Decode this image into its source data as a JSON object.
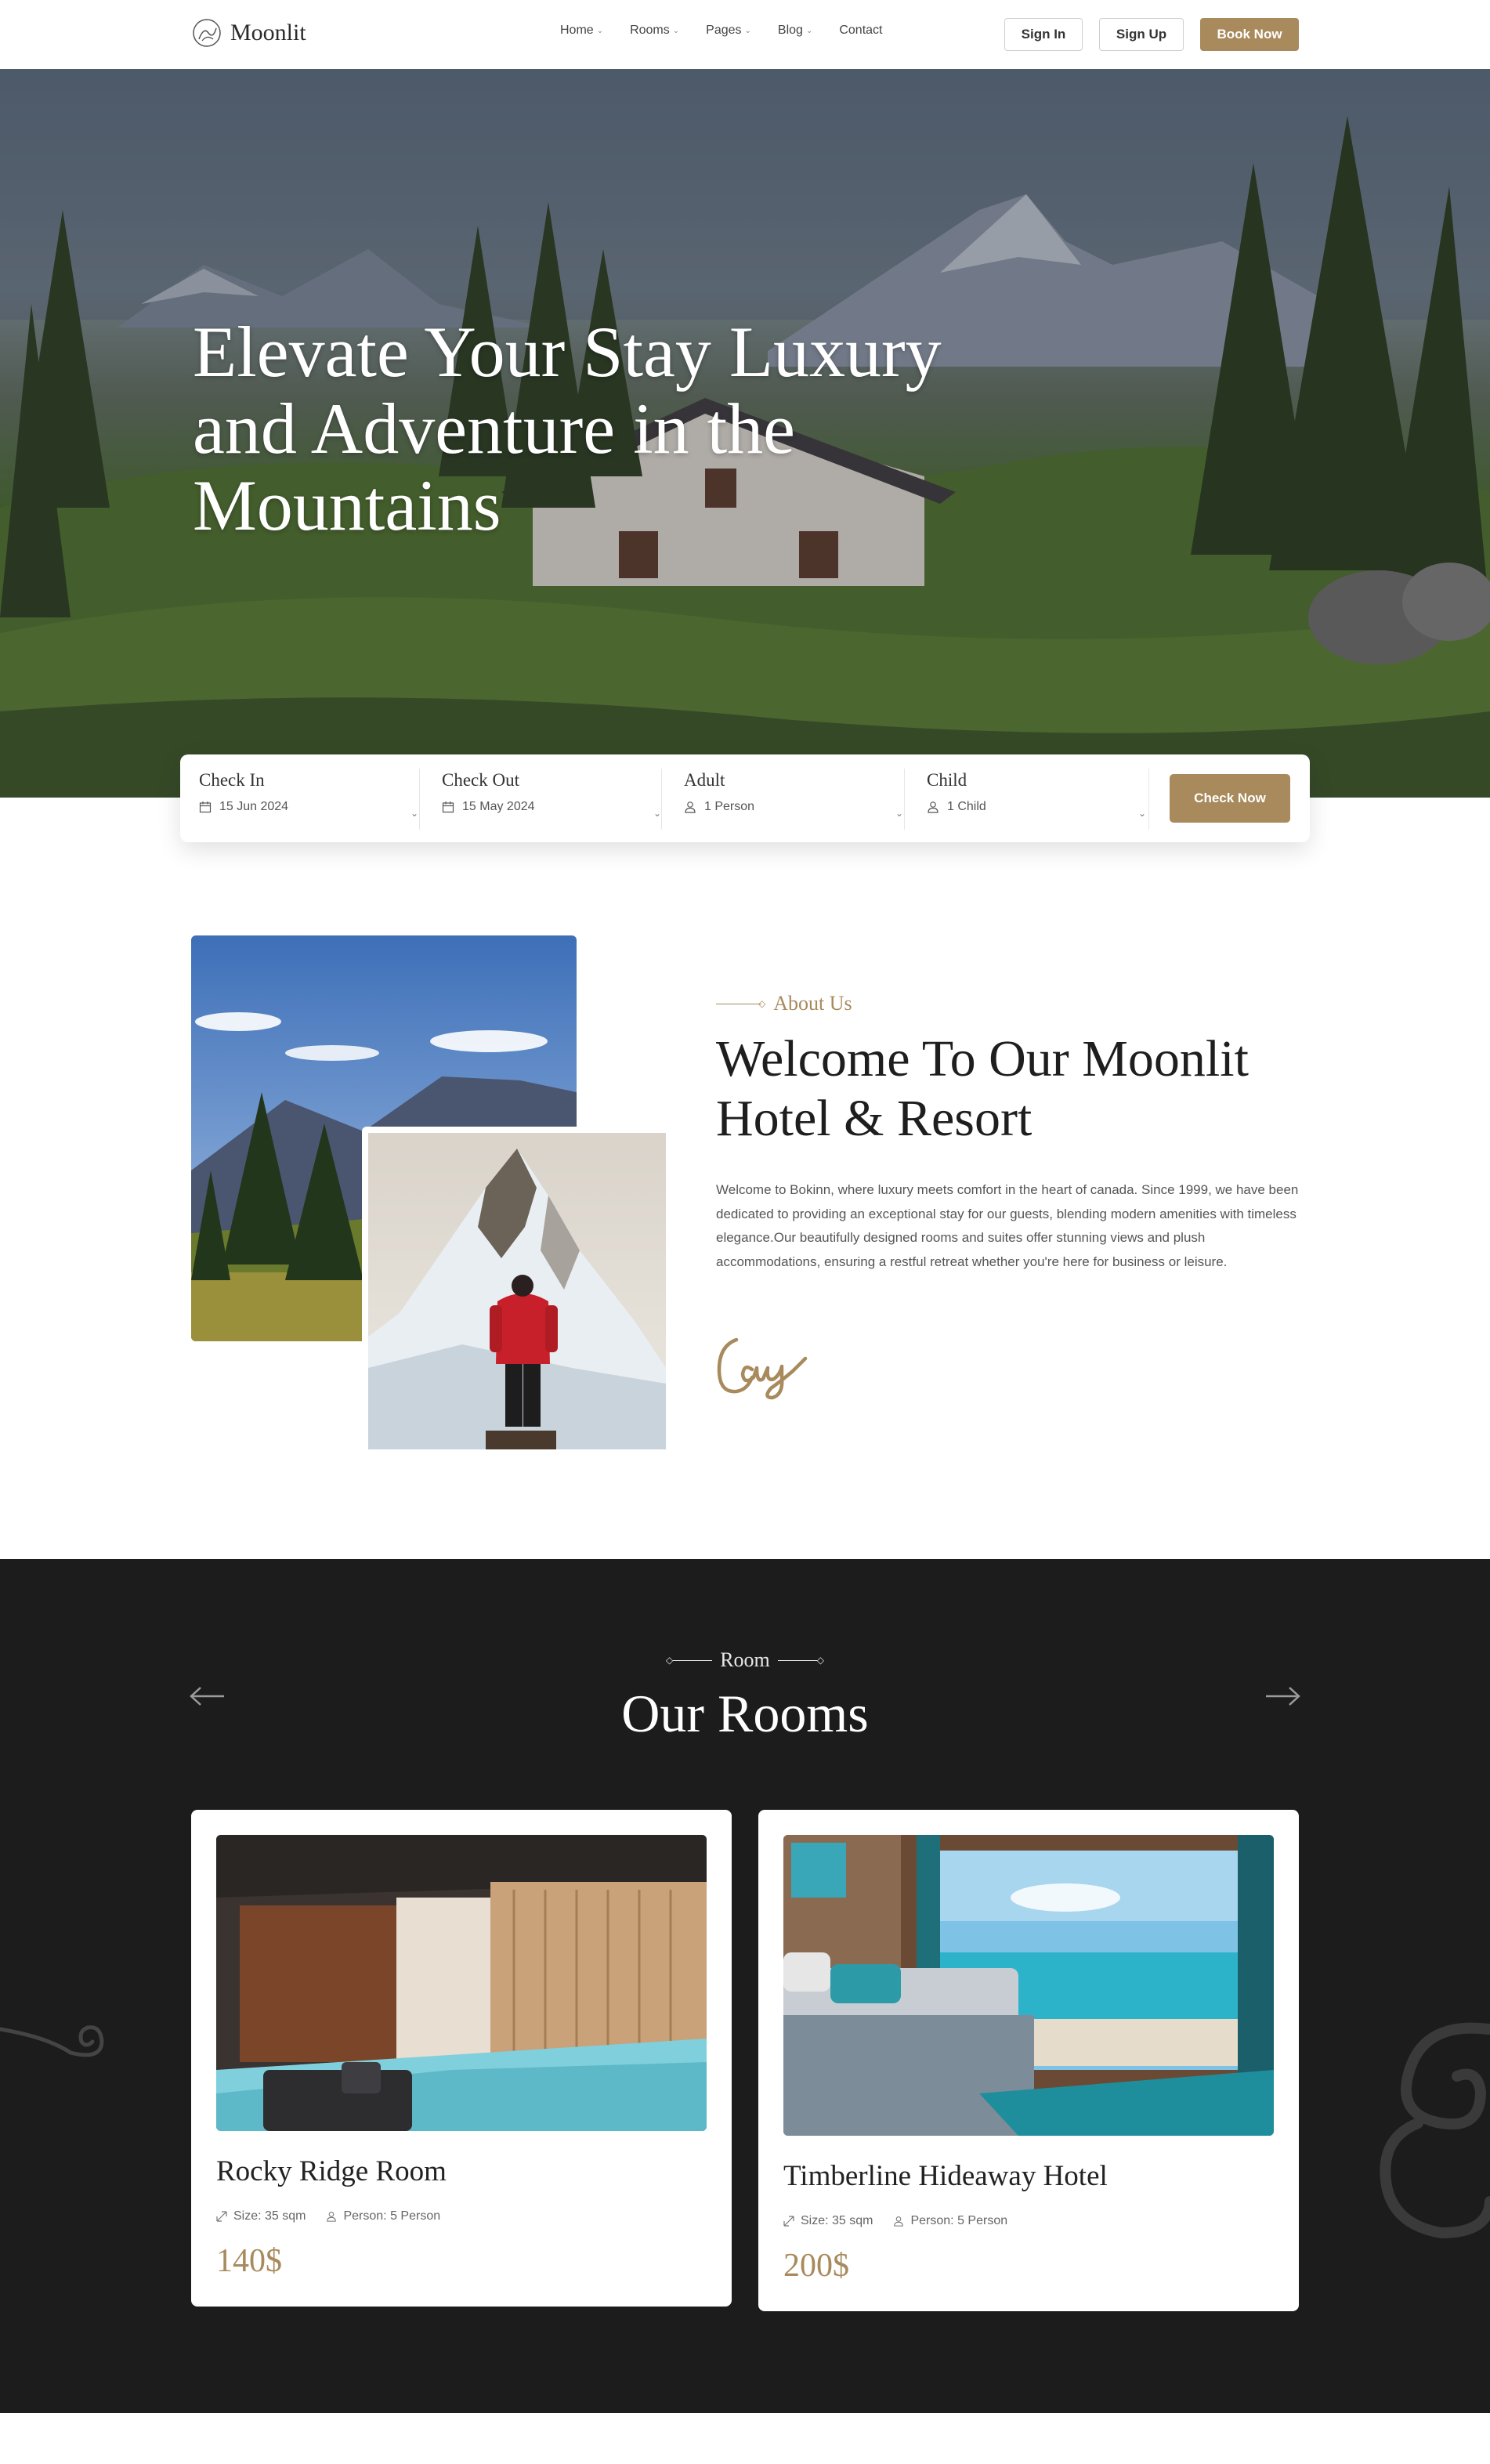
{
  "header": {
    "logo_text": "Moonlit",
    "nav": [
      {
        "label": "Home",
        "has_dropdown": true
      },
      {
        "label": "Rooms",
        "has_dropdown": true
      },
      {
        "label": "Pages",
        "has_dropdown": true
      },
      {
        "label": "Blog",
        "has_dropdown": true
      },
      {
        "label": "Contact",
        "has_dropdown": false
      }
    ],
    "sign_in": "Sign In",
    "sign_up": "Sign Up",
    "book_now": "Book Now"
  },
  "hero": {
    "title_lines": [
      "Elevate Your Stay Luxury",
      "and Adventure in the",
      "Mountains"
    ]
  },
  "booking": {
    "check_in": {
      "label": "Check In",
      "value": "15 Jun 2024",
      "icon": "calendar-icon"
    },
    "check_out": {
      "label": "Check Out",
      "value": "15 May 2024",
      "icon": "calendar-icon"
    },
    "adult": {
      "label": "Adult",
      "value": "1 Person",
      "icon": "user-icon"
    },
    "child": {
      "label": "Child",
      "value": "1 Child",
      "icon": "user-icon"
    },
    "button": "Check Now"
  },
  "about": {
    "eyebrow": "About Us",
    "title_lines": [
      "Welcome To Our Moonlit",
      "Hotel & Resort"
    ],
    "text": "Welcome to Bokinn, where luxury meets comfort in the heart of canada. Since 1999, we have been dedicated to providing an exceptional stay for our guests, blending modern amenities with timeless elegance.Our beautifully designed rooms and suites offer stunning views and plush accommodations, ensuring a restful retreat whether you're here for business or leisure."
  },
  "rooms": {
    "eyebrow": "Room",
    "title": "Our Rooms",
    "items": [
      {
        "name": "Rocky Ridge Room",
        "size": "Size: 35 sqm",
        "person": "Person: 5 Person",
        "price": "140$"
      },
      {
        "name": "Timberline Hideaway Hotel",
        "size": "Size: 35 sqm",
        "person": "Person: 5 Person",
        "price": "200$"
      }
    ]
  },
  "colors": {
    "accent": "#a88a5c",
    "dark_section": "#1c1c1c",
    "text_dark": "#1e1e1e"
  }
}
